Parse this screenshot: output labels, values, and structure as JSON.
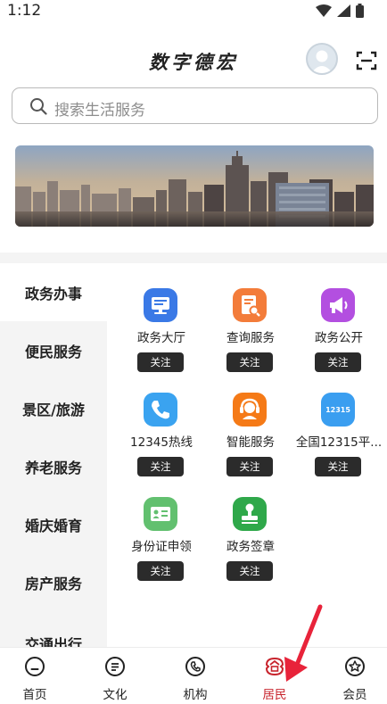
{
  "status_bar": {
    "time": "1:12"
  },
  "header": {
    "title": "数字德宏"
  },
  "search": {
    "placeholder": "搜索生活服务"
  },
  "sidebar": {
    "items": [
      {
        "label": "政务办事",
        "active": true
      },
      {
        "label": "便民服务"
      },
      {
        "label": "景区/旅游"
      },
      {
        "label": "养老服务"
      },
      {
        "label": "婚庆婚育"
      },
      {
        "label": "房产服务"
      },
      {
        "label": "交通出行"
      }
    ]
  },
  "services": [
    {
      "label": "政务大厅",
      "follow": "关注",
      "icon": "hall-icon",
      "color": "#3a79e6"
    },
    {
      "label": "查询服务",
      "follow": "关注",
      "icon": "query-icon",
      "color": "#f37c3a"
    },
    {
      "label": "政务公开",
      "follow": "关注",
      "icon": "megaphone-icon",
      "color": "#b34fe0"
    },
    {
      "label": "12345热线",
      "follow": "关注",
      "icon": "phone-icon",
      "color": "#3aa3f0"
    },
    {
      "label": "智能服务",
      "follow": "关注",
      "icon": "headset-icon",
      "color": "#f57a17"
    },
    {
      "label": "全国12315平...",
      "follow": "关注",
      "icon": "badge-12315-icon",
      "color": "#3a9ef0",
      "badge_text": "12315"
    },
    {
      "label": "身份证申领",
      "follow": "关注",
      "icon": "id-card-icon",
      "color": "#62c06f"
    },
    {
      "label": "政务签章",
      "follow": "关注",
      "icon": "stamp-icon",
      "color": "#2fa84a"
    }
  ],
  "bottom_nav": {
    "items": [
      {
        "label": "首页",
        "icon": "home-icon"
      },
      {
        "label": "文化",
        "icon": "culture-icon"
      },
      {
        "label": "机构",
        "icon": "institution-icon"
      },
      {
        "label": "居民",
        "icon": "resident-icon",
        "active": true
      },
      {
        "label": "会员",
        "icon": "member-icon"
      }
    ]
  },
  "colors": {
    "accent": "#c8242d",
    "follow_button": "#2b2b2b",
    "sidebar_bg": "#f4f4f4"
  }
}
